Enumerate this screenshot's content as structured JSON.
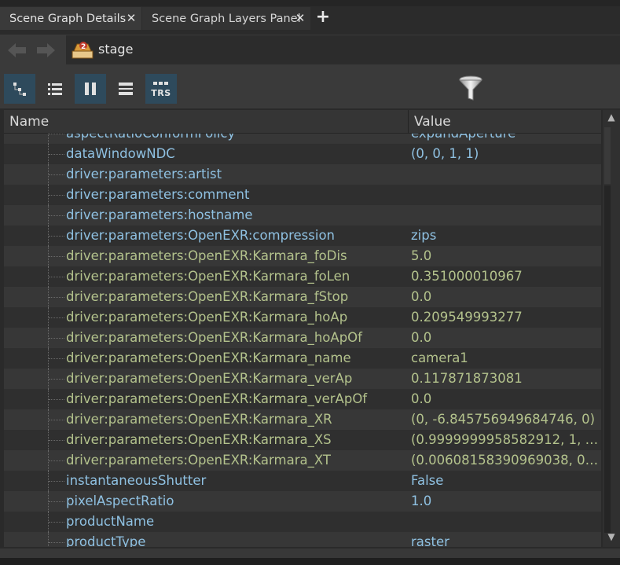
{
  "tabs": [
    {
      "label": "Scene Graph Details",
      "active": true
    },
    {
      "label": "Scene Graph Layers Panel",
      "active": false
    }
  ],
  "tab_close_glyph": "✕",
  "tab_add_glyph": "+",
  "path": {
    "text": "stage",
    "icon": "lop-network-icon"
  },
  "toolbar": {
    "trs_label": "TRS"
  },
  "tree": {
    "columns": {
      "name": "Name",
      "value": "Value"
    },
    "rows": [
      {
        "name": "aspectRatioConformPolicy",
        "value": "expandAperture",
        "style": "blue"
      },
      {
        "name": "dataWindowNDC",
        "value": "(0, 0, 1, 1)",
        "style": "blue"
      },
      {
        "name": "driver:parameters:artist",
        "value": "",
        "style": "blue"
      },
      {
        "name": "driver:parameters:comment",
        "value": "",
        "style": "blue"
      },
      {
        "name": "driver:parameters:hostname",
        "value": "",
        "style": "blue"
      },
      {
        "name": "driver:parameters:OpenEXR:compression",
        "value": "zips",
        "style": "blue"
      },
      {
        "name": "driver:parameters:OpenEXR:Karmara_foDis",
        "value": "5.0",
        "style": "olive"
      },
      {
        "name": "driver:parameters:OpenEXR:Karmara_foLen",
        "value": "0.351000010967",
        "style": "olive"
      },
      {
        "name": "driver:parameters:OpenEXR:Karmara_fStop",
        "value": "0.0",
        "style": "olive"
      },
      {
        "name": "driver:parameters:OpenEXR:Karmara_hoAp",
        "value": "0.209549993277",
        "style": "olive"
      },
      {
        "name": "driver:parameters:OpenEXR:Karmara_hoApOf",
        "value": "0.0",
        "style": "olive"
      },
      {
        "name": "driver:parameters:OpenEXR:Karmara_name",
        "value": "camera1",
        "style": "olive"
      },
      {
        "name": "driver:parameters:OpenEXR:Karmara_verAp",
        "value": "0.117871873081",
        "style": "olive"
      },
      {
        "name": "driver:parameters:OpenEXR:Karmara_verApOf",
        "value": "0.0",
        "style": "olive"
      },
      {
        "name": "driver:parameters:OpenEXR:Karmara_XR",
        "value": "(0, -6.845756949684746, 0)",
        "style": "olive"
      },
      {
        "name": "driver:parameters:OpenEXR:Karmara_XS",
        "value": "(0.9999999958582912, 1, 0…",
        "style": "olive"
      },
      {
        "name": "driver:parameters:OpenEXR:Karmara_XT",
        "value": "(0.00608158390969038, 0, …",
        "style": "olive"
      },
      {
        "name": "instantaneousShutter",
        "value": "False",
        "style": "blue"
      },
      {
        "name": "pixelAspectRatio",
        "value": "1.0",
        "style": "blue"
      },
      {
        "name": "productName",
        "value": "",
        "style": "blue"
      },
      {
        "name": "productType",
        "value": "raster",
        "style": "blue"
      }
    ]
  },
  "colors": {
    "name_blue": "#8fc1e2",
    "name_olive": "#b3c28c",
    "toggle_on": "#2e4a5c"
  }
}
